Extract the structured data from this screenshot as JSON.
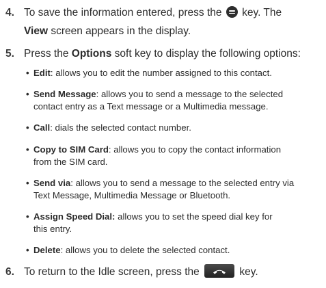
{
  "steps": [
    {
      "number": "4.",
      "line1_pre": "To save the information entered, press the ",
      "key_icon": "ok-key-icon",
      "line1_post": " key. The",
      "line2_bold": "View",
      "line2_rest": " screen appears in the display."
    },
    {
      "number": "5.",
      "pre": "Press the ",
      "bold": "Options",
      "post": " soft key to display the following options:"
    },
    {
      "number": "6.",
      "pre": "To return to the Idle screen, press the ",
      "key_icon": "end-key-icon",
      "post": " key."
    }
  ],
  "options": [
    {
      "bullet": "•",
      "term": "Edit",
      "sep": ": ",
      "desc": "allows you to edit the number assigned to this contact."
    },
    {
      "bullet": "•",
      "term": "Send Message",
      "sep": ": ",
      "desc_line1": "allows you to send a message to the selected",
      "desc_line2": "contact entry as a Text message or a Multimedia message."
    },
    {
      "bullet": "•",
      "term": "Call",
      "sep": ": ",
      "desc": "dials the selected contact number."
    },
    {
      "bullet": "•",
      "term": "Copy to SIM Card",
      "sep": ": ",
      "desc_line1": "allows you to copy the contact information",
      "desc_line2": "from the SIM card."
    },
    {
      "bullet": "•",
      "term": "Send via",
      "sep": ": ",
      "desc_line1": "allows you to send a message to the selected entry via",
      "desc_line2": "Text Message, Multimedia Message or Bluetooth."
    },
    {
      "bullet": "•",
      "term": "Assign Speed Dial:",
      "sep": " ",
      "desc_line1": "allows you to set the speed dial key for",
      "desc_line2": "this entry."
    },
    {
      "bullet": "•",
      "term": "Delete",
      "sep": ": ",
      "desc": "allows you to delete the selected contact."
    }
  ]
}
